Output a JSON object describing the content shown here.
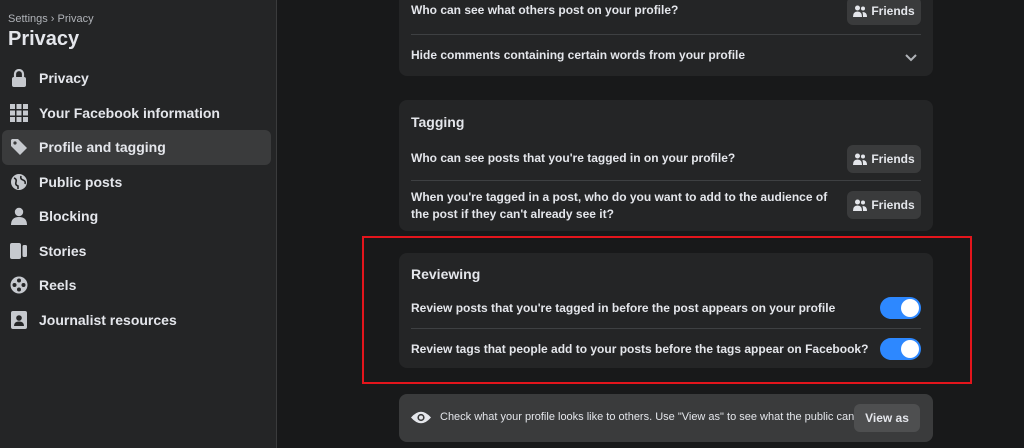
{
  "sidebar": {
    "breadcrumb": "Settings › Privacy",
    "title": "Privacy",
    "items": [
      {
        "label": "Privacy",
        "icon": "lock-icon"
      },
      {
        "label": "Your Facebook information",
        "icon": "grid-icon"
      },
      {
        "label": "Profile and tagging",
        "icon": "tag-icon",
        "active": true
      },
      {
        "label": "Public posts",
        "icon": "globe-icon"
      },
      {
        "label": "Blocking",
        "icon": "person-icon"
      },
      {
        "label": "Stories",
        "icon": "stories-icon"
      },
      {
        "label": "Reels",
        "icon": "reels-icon"
      },
      {
        "label": "Journalist resources",
        "icon": "journalist-icon"
      }
    ]
  },
  "profile_card": {
    "others_post_label": "Who can see what others post on your profile?",
    "others_post_value": "Friends",
    "hide_comments_label": "Hide comments containing certain words from your profile"
  },
  "tagging": {
    "title": "Tagging",
    "tagged_posts_label": "Who can see posts that you're tagged in on your profile?",
    "tagged_posts_value": "Friends",
    "audience_label": "When you're tagged in a post, who do you want to add to the audience of the post if they can't already see it?",
    "audience_value": "Friends"
  },
  "reviewing": {
    "title": "Reviewing",
    "review_posts_label": "Review posts that you're tagged in before the post appears on your profile",
    "review_posts_on": true,
    "review_tags_label": "Review tags that people add to your posts before the tags appear on Facebook?",
    "review_tags_on": true
  },
  "view_as": {
    "text": "Check what your profile looks like to others. Use \"View as\" to see what the public can see.",
    "button": "View as"
  },
  "colors": {
    "accent": "#2d88ff",
    "highlight_border": "#e3151c"
  }
}
